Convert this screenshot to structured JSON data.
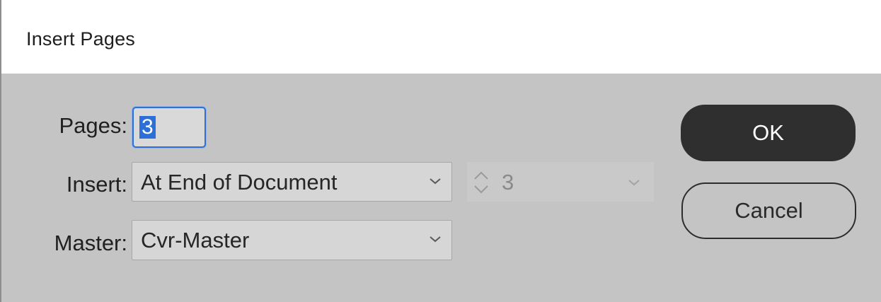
{
  "dialog": {
    "title": "Insert Pages"
  },
  "form": {
    "pages_label": "Pages:",
    "pages_value": "3",
    "insert_label": "Insert:",
    "insert_value": "At End of Document",
    "insert_page_number": "3",
    "master_label": "Master:",
    "master_value": "Cvr-Master"
  },
  "buttons": {
    "ok_label": "OK",
    "cancel_label": "Cancel"
  },
  "colors": {
    "dialog_background": "#c4c4c4",
    "ok_button": "#2f2f2f",
    "focus_ring": "#2f6fd6"
  },
  "icons": {
    "dropdown": "chevron-down-icon",
    "spinner": "stepper-icon"
  }
}
